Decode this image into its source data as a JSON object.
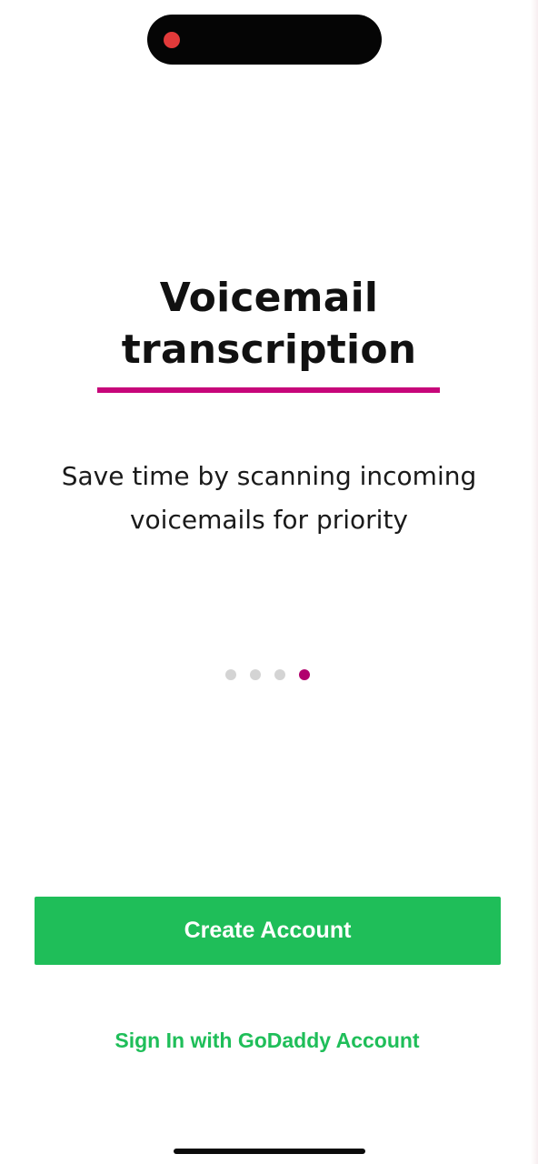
{
  "onboarding": {
    "title": "Voicemail transcription",
    "subtitle": "Save time by scanning incoming voicemails for priority",
    "pagination": {
      "total_pages": 4,
      "current_page": 4
    }
  },
  "actions": {
    "create_account_label": "Create Account",
    "sign_in_label": "Sign In with GoDaddy Account"
  },
  "colors": {
    "accent": "#c7067a",
    "active_dot": "#b1006d",
    "primary_green": "#1fbe59",
    "inactive_dot": "#d4d4d4"
  },
  "status_indicators": {
    "recording_icon": "red-dot"
  }
}
